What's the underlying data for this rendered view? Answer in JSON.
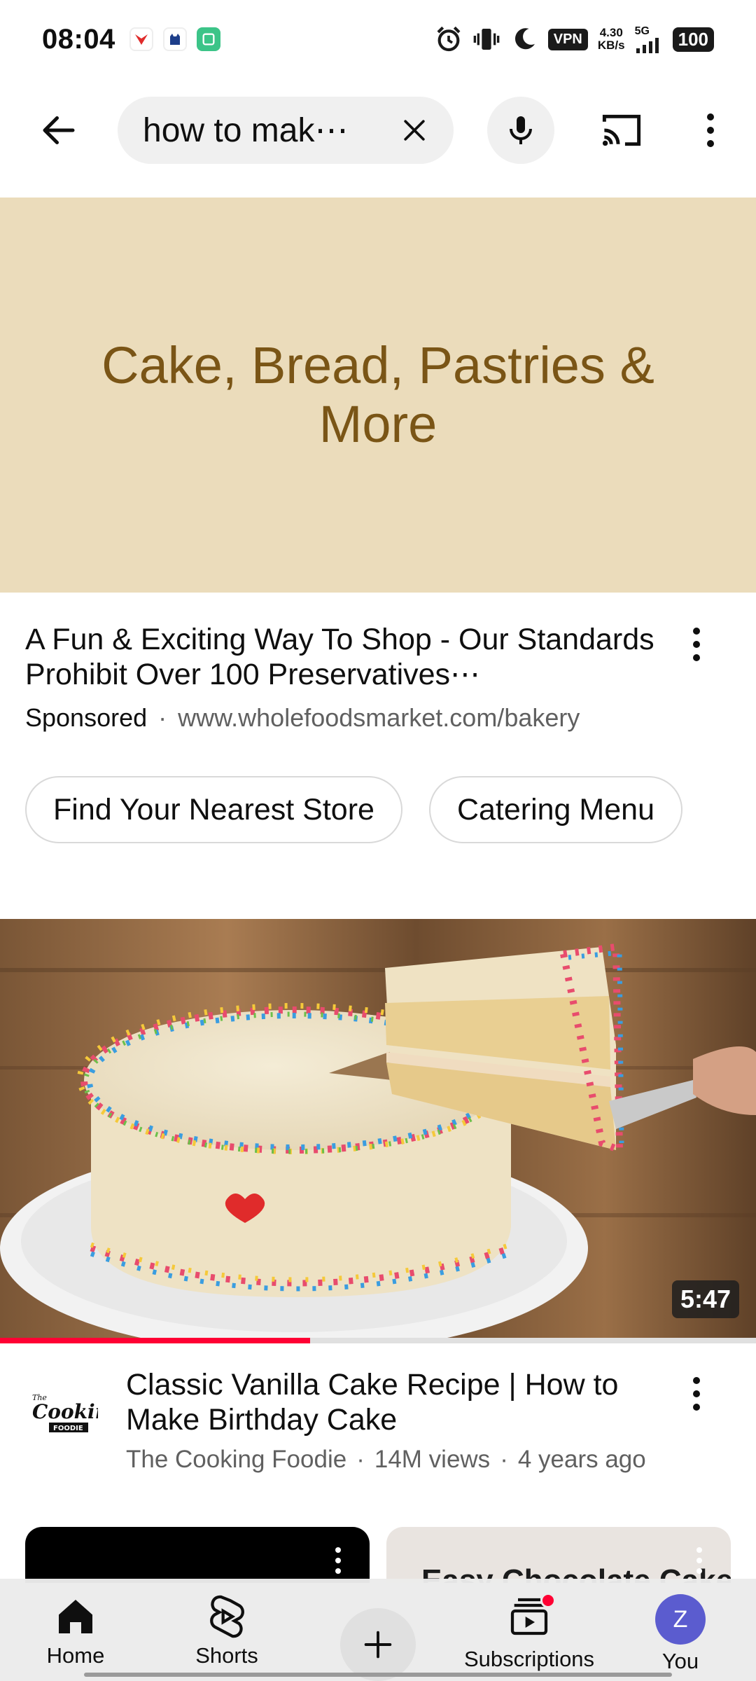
{
  "status_bar": {
    "time": "08:04",
    "vpn": "VPN",
    "net_speed_value": "4.30",
    "net_speed_unit": "KB/s",
    "network": "5G",
    "battery": "100"
  },
  "search": {
    "query": "how to mak⋯",
    "icons": [
      "back-arrow-icon",
      "close-icon",
      "mic-icon",
      "cast-icon",
      "more-vert-icon"
    ]
  },
  "ad": {
    "banner_title": "Cake, Bread, Pastries & More",
    "banner_bg": "#ebdcbb",
    "banner_text_color": "#7a5516",
    "headline": "A Fun & Exciting Way To Shop - Our Standards Prohibit Over 100 Preservatives⋯",
    "sponsored_label": "Sponsored",
    "separator": "·",
    "url": "www.wholefoodsmarket.com/bakery",
    "chips": [
      "Find Your Nearest Store",
      "Catering Menu"
    ]
  },
  "video": {
    "duration": "5:47",
    "progress_percent": 41,
    "title": "Classic Vanilla Cake Recipe | How to Make Birthday Cake",
    "channel": "The Cooking Foodie",
    "views": "14M views",
    "age": "4 years ago",
    "separator": "·",
    "channel_logo_text_1": "The",
    "channel_logo_text_2": "Cooking",
    "channel_logo_text_3": "FOODIE"
  },
  "next_cards": {
    "right_card_text": "Easy Chocolate Cake"
  },
  "bottom_nav": {
    "items": [
      {
        "label": "Home",
        "icon": "home-icon"
      },
      {
        "label": "Shorts",
        "icon": "shorts-icon"
      },
      {
        "label": "",
        "icon": "create-plus-icon"
      },
      {
        "label": "Subscriptions",
        "icon": "subscriptions-icon"
      },
      {
        "label": "You",
        "icon": "avatar"
      }
    ],
    "avatar_letter": "Z",
    "accent": "#ff0033"
  }
}
